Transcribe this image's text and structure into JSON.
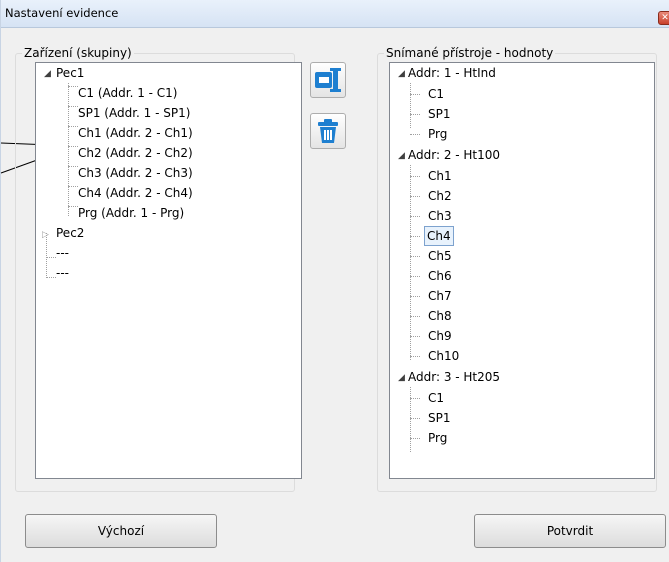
{
  "window": {
    "title": "Nastavení evidence",
    "close_glyph": "✕"
  },
  "left_group": {
    "label": "Zařízení (skupiny)",
    "tree": {
      "pec1": {
        "label": "Pec1",
        "children": [
          "C1 (Addr. 1 - C1)",
          "SP1 (Addr. 1 - SP1)",
          "Ch1 (Addr. 2 - Ch1)",
          "Ch2 (Addr. 2 - Ch2)",
          "Ch3 (Addr. 2 - Ch3)",
          "Ch4 (Addr. 2 - Ch4)",
          "Prg (Addr. 1 - Prg)"
        ]
      },
      "pec2": {
        "label": "Pec2"
      },
      "placeholders": [
        "---",
        "---"
      ]
    }
  },
  "right_group": {
    "label": "Snímané přístroje - hodnoty",
    "tree": {
      "addr1": {
        "label": "Addr: 1 - HtInd",
        "children": [
          "C1",
          "SP1",
          "Prg"
        ]
      },
      "addr2": {
        "label": "Addr: 2 - Ht100",
        "children": [
          "Ch1",
          "Ch2",
          "Ch3",
          "Ch4",
          "Ch5",
          "Ch6",
          "Ch7",
          "Ch8",
          "Ch9",
          "Ch10"
        ],
        "selected": "Ch4"
      },
      "addr3": {
        "label": "Addr: 3 - Ht205",
        "children": [
          "C1",
          "SP1",
          "Prg"
        ]
      }
    }
  },
  "toolbar": {
    "assign_icon": "assign-to-group-icon",
    "delete_icon": "trash-icon"
  },
  "footer": {
    "default_label": "Výchozí",
    "confirm_label": "Potvrdit"
  },
  "colors": {
    "icon_blue": "#1e7fd0",
    "selection_border": "#7da2ce",
    "selection_fill": "#e8f2fc"
  }
}
